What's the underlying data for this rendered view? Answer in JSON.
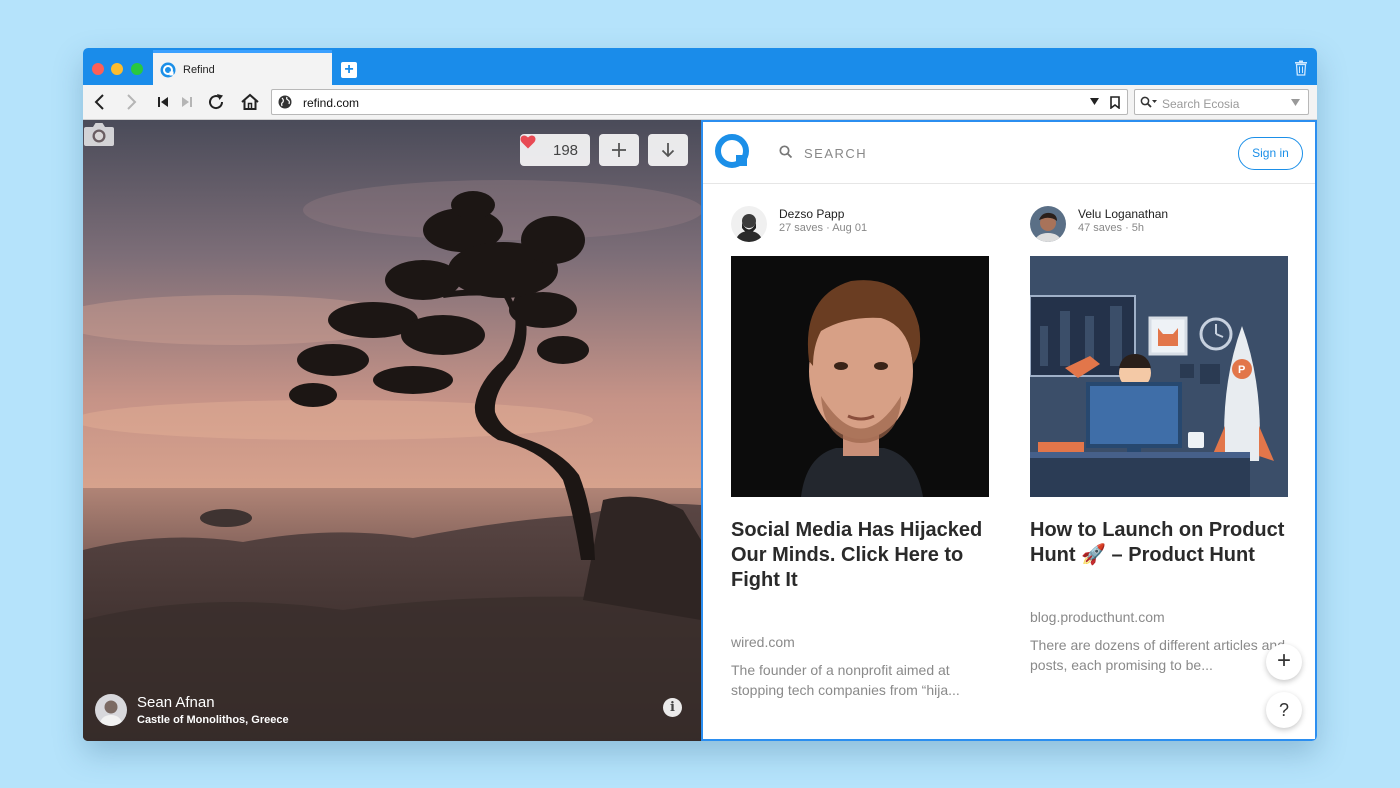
{
  "browser": {
    "tab_title": "Refind",
    "url": "refind.com",
    "search_placeholder": "Search Ecosia"
  },
  "photo": {
    "likes": "198",
    "photographer": "Sean Afnan",
    "location": "Castle of Monolithos, Greece",
    "info_label": "i"
  },
  "refind": {
    "search_label": "SEARCH",
    "signin_label": "Sign in",
    "cards": [
      {
        "author": "Dezso Papp",
        "meta": "27 saves · Aug 01",
        "title": "Social Media Has Hijacked Our Minds. Click Here to Fight It",
        "source": "wired.com",
        "description": "The founder of a nonprofit aimed at stopping tech companies from “hija..."
      },
      {
        "author": "Velu Loganathan",
        "meta": "47 saves · 5h",
        "title": "How to Launch on Product Hunt 🚀 – Product Hunt",
        "source": "blog.producthunt.com",
        "description": "There are dozens of different articles and posts, each promising to be..."
      }
    ],
    "fab_add": "+",
    "fab_help": "?"
  },
  "colors": {
    "titlebar": "#1a8cea",
    "accent": "#1b8fe8",
    "refind_border": "#2b8ef0"
  }
}
